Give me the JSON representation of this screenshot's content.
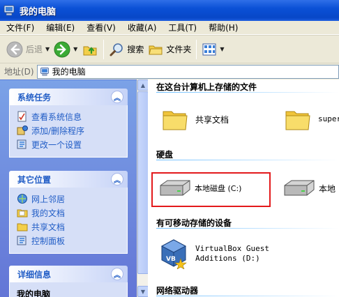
{
  "window": {
    "title": "我的电脑"
  },
  "menu": [
    "文件(F)",
    "编辑(E)",
    "查看(V)",
    "收藏(A)",
    "工具(T)",
    "帮助(H)"
  ],
  "toolbar": {
    "back": "后退",
    "search": "搜索",
    "folders": "文件夹"
  },
  "address": {
    "label": "地址(D)",
    "value": "我的电脑"
  },
  "left": {
    "tasks": {
      "title": "系统任务",
      "items": [
        "查看系统信息",
        "添加/删除程序",
        "更改一个设置"
      ]
    },
    "places": {
      "title": "其它位置",
      "items": [
        "网上邻居",
        "我的文档",
        "共享文档",
        "控制面板"
      ]
    },
    "details": {
      "title": "详细信息",
      "name": "我的电脑"
    }
  },
  "content": {
    "stored": {
      "header": "在这台计算机上存储的文件",
      "items": [
        "共享文档",
        "super"
      ]
    },
    "drives": {
      "header": "硬盘",
      "items": [
        "本地磁盘 (C:)",
        "本地"
      ]
    },
    "removable": {
      "header": "有可移动存储的设备",
      "items": [
        "VirtualBox Guest",
        "Additions (D:)"
      ]
    },
    "network": {
      "header": "网络驱动器"
    }
  },
  "colors": {
    "titlebar": "#0a50d6",
    "panel_link": "#215dc6",
    "selection": "#e3191b"
  }
}
